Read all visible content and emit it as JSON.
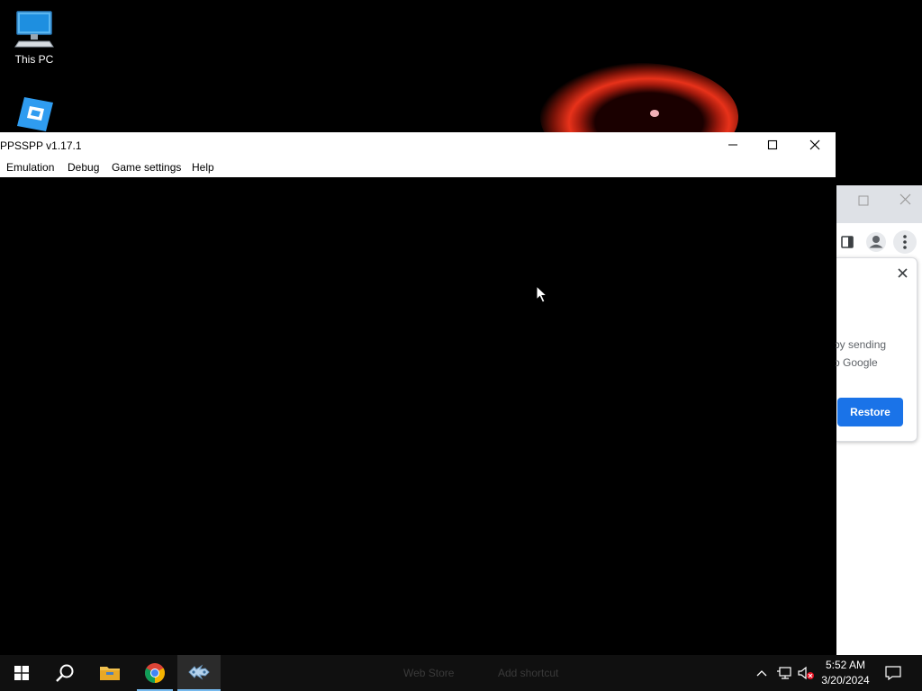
{
  "desktop": {
    "icons": [
      {
        "label": "This PC",
        "icon": "monitor-icon"
      },
      {
        "label": "",
        "icon": "roblox-studio-icon"
      }
    ]
  },
  "ppsspp": {
    "title": "PPSSPP v1.17.1",
    "menu": [
      "Emulation",
      "Debug",
      "Game settings",
      "Help"
    ]
  },
  "chrome": {
    "popup_line1": "by sending",
    "popup_line2": "o Google",
    "restore_label": "Restore",
    "accent": "#1a73e8"
  },
  "taskbar": {
    "ghost_left": "Web Store",
    "ghost_right": "Add shortcut",
    "time": "5:52 AM",
    "date": "3/20/2024",
    "icons": [
      "windows-start-icon",
      "search-icon",
      "file-explorer-icon",
      "chrome-icon",
      "ppsspp-icon"
    ]
  }
}
